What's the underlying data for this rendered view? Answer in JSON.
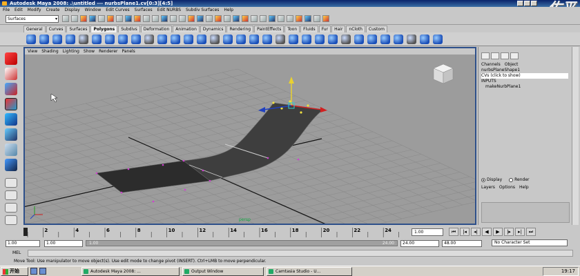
{
  "window": {
    "title": "Autodesk Maya 2008: .\\untitled  ---  nurbsPlane1.cv[0:3][4:5]",
    "watermark": "佐平"
  },
  "menubar": [
    "File",
    "Edit",
    "Modify",
    "Create",
    "Display",
    "Window",
    "Edit Curves",
    "Surfaces",
    "Edit NURBS",
    "Subdiv Surfaces",
    "Help"
  ],
  "statusline": {
    "mode": "Surfaces"
  },
  "shelf_tabs": [
    "General",
    "Curves",
    "Surfaces",
    "Polygons",
    "Subdivs",
    "Deformation",
    "Animation",
    "Dynamics",
    "Rendering",
    "PaintEffects",
    "Toon",
    "Fluids",
    "Fur",
    "Hair",
    "nCloth",
    "Custom"
  ],
  "shelf_active": "Polygons",
  "viewport": {
    "panel_menu": [
      "View",
      "Shading",
      "Lighting",
      "Show",
      "Renderer",
      "Panels"
    ],
    "camera_label": "persp"
  },
  "channel_box": {
    "tabs": [
      "Channels",
      "Object"
    ],
    "lines": [
      "nurbsPlaneShape1",
      "CVs (click to show)",
      "INPUTS",
      "makeNurbPlane1"
    ],
    "display_radio": "Display",
    "render_radio": "Render",
    "layer_menu": [
      "Layers",
      "Options",
      "Help"
    ]
  },
  "timeslider": {
    "ticks": [
      "2",
      "4",
      "6",
      "8",
      "10",
      "12",
      "14",
      "16",
      "18",
      "20",
      "22",
      "24"
    ],
    "current_frame": "1.00"
  },
  "range": {
    "start": "1.00",
    "playback_start": "1.00",
    "slider_start": "1.00",
    "slider_end": "24.00",
    "playback_end": "24.00",
    "end": "48.00",
    "character_set": "No Character Set"
  },
  "cmdline": {
    "label": "MEL"
  },
  "helpline": "Move Tool: Use manipulator to move object(s). Use edit mode to change pivot (INSERT). Ctrl+LMB to move perpendicular.",
  "taskbar": {
    "start": "开始",
    "tasks": [
      "Autodesk Maya 2008: ...",
      "Output Window",
      "Camtasia Studio - U..."
    ],
    "clock": "19:17"
  }
}
